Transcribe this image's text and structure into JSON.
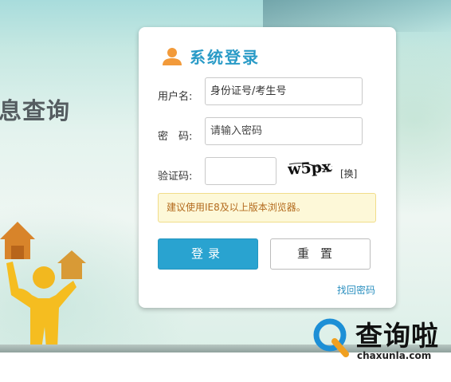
{
  "background": {
    "headline": "息查询"
  },
  "login_panel": {
    "title": "系统登录",
    "username_label": "用户名:",
    "username_value": "身份证号/考生号",
    "password_label": "密　码:",
    "password_placeholder": "请输入密码",
    "captcha_label": "验证码:",
    "captcha_value": "",
    "captcha_image_text": "w5px",
    "captcha_refresh": "[换]",
    "notice": "建议使用IE8及以上版本浏览器。",
    "login_button": "登录",
    "reset_button": "重置",
    "forgot_link": "找回密码",
    "accent_color": "#29a3d0",
    "user_icon": "user-icon"
  },
  "watermark": {
    "name_cn": "查询啦",
    "name_en": "chaxunla.com",
    "icon": "q-logo-icon"
  }
}
